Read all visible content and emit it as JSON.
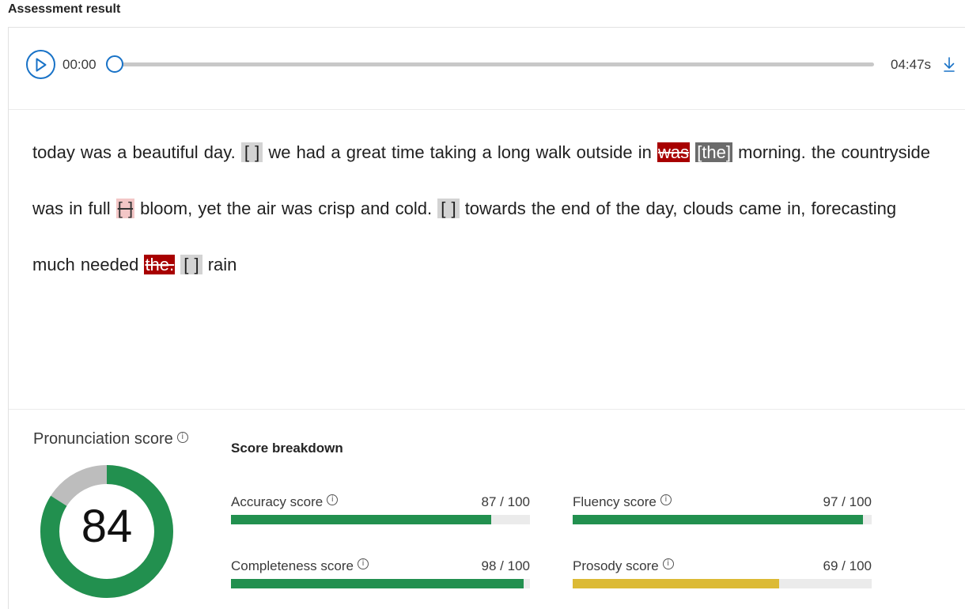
{
  "section_title": "Assessment result",
  "player": {
    "current_time": "00:00",
    "duration": "04:47s",
    "progress": 0,
    "play_icon": "play-icon",
    "download_icon": "download-icon",
    "accent_color": "#1872c7"
  },
  "transcript": [
    {
      "t": "text",
      "v": "today was a beautiful day. "
    },
    {
      "t": "gap",
      "v": "[ ]"
    },
    {
      "t": "text",
      "v": " we had a great time taking a long walk outside in "
    },
    {
      "t": "omit",
      "v": "was"
    },
    {
      "t": "text",
      "v": " "
    },
    {
      "t": "insert",
      "v": "[the]"
    },
    {
      "t": "text",
      "v": " morning. the countryside was in full "
    },
    {
      "t": "omit-light",
      "v": "[ ]"
    },
    {
      "t": "text",
      "v": " bloom, yet the air was crisp and cold. "
    },
    {
      "t": "gap",
      "v": "[ ]"
    },
    {
      "t": "text",
      "v": " towards the end of the day, clouds came in, forecasting much needed "
    },
    {
      "t": "omit",
      "v": "the."
    },
    {
      "t": "text",
      "v": " "
    },
    {
      "t": "gap",
      "v": "[ ]"
    },
    {
      "t": "text",
      "v": " rain"
    }
  ],
  "pronunciation": {
    "title": "Pronunciation score",
    "info_icon": "info-icon",
    "score": 84,
    "max": 100,
    "color_good": "#22904f",
    "color_rest": "#bdbdbd"
  },
  "breakdown": {
    "title": "Score breakdown",
    "metrics": [
      {
        "label": "Accuracy score",
        "value": "87 / 100",
        "score": 87,
        "color": "#22904f"
      },
      {
        "label": "Fluency score",
        "value": "97 / 100",
        "score": 97,
        "color": "#22904f"
      },
      {
        "label": "Completeness score",
        "value": "98 / 100",
        "score": 98,
        "color": "#22904f"
      },
      {
        "label": "Prosody score",
        "value": "69 / 100",
        "score": 69,
        "color": "#dcba35"
      }
    ]
  }
}
